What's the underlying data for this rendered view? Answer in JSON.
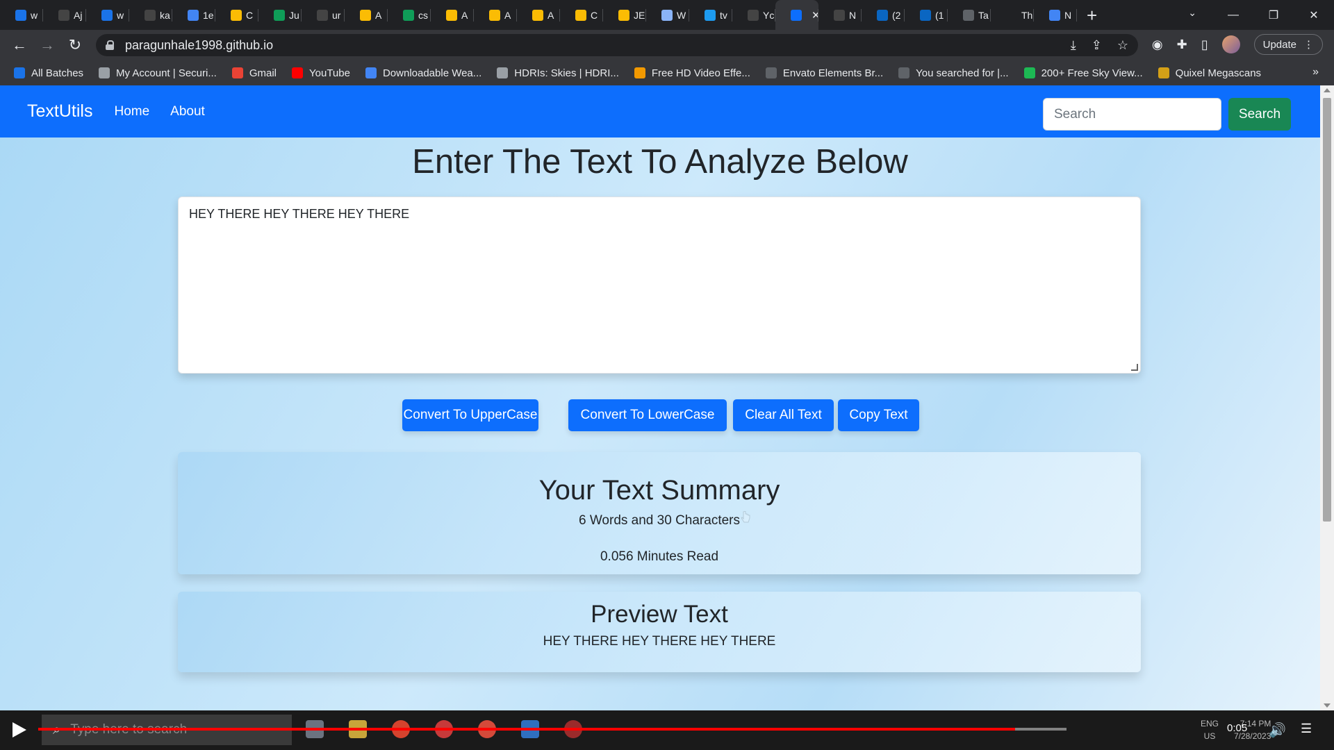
{
  "browser": {
    "tabs": [
      {
        "label": "w",
        "icon": "play-favicon-icon",
        "color": "#1a73e8"
      },
      {
        "label": "Aj",
        "icon": "github-favicon-icon",
        "color": "#444444"
      },
      {
        "label": "w",
        "icon": "play-favicon-icon",
        "color": "#1a73e8"
      },
      {
        "label": "ka",
        "icon": "github-favicon-icon",
        "color": "#444444"
      },
      {
        "label": "1e",
        "icon": "circle-favicon-icon",
        "color": "#4285f4"
      },
      {
        "label": "C",
        "icon": "drive-favicon-icon",
        "color": "#fbbc04"
      },
      {
        "label": "Ju",
        "icon": "sheets-favicon-icon",
        "color": "#0f9d58"
      },
      {
        "label": "ur",
        "icon": "github-favicon-icon",
        "color": "#444444"
      },
      {
        "label": "A",
        "icon": "drive-favicon-icon",
        "color": "#fbbc04"
      },
      {
        "label": "cs",
        "icon": "sheets-favicon-icon",
        "color": "#0f9d58"
      },
      {
        "label": "A",
        "icon": "drive-favicon-icon",
        "color": "#fbbc04"
      },
      {
        "label": "A",
        "icon": "drive-favicon-icon",
        "color": "#fbbc04"
      },
      {
        "label": "A",
        "icon": "drive-favicon-icon",
        "color": "#fbbc04"
      },
      {
        "label": "C",
        "icon": "drive-favicon-icon",
        "color": "#fbbc04"
      },
      {
        "label": "JE",
        "icon": "drive-favicon-icon",
        "color": "#fbbc04"
      },
      {
        "label": "W",
        "icon": "window-favicon-icon",
        "color": "#8ab4f8"
      },
      {
        "label": "tv",
        "icon": "twitter-favicon-icon",
        "color": "#1d9bf0"
      },
      {
        "label": "Yc",
        "icon": "github-favicon-icon",
        "color": "#444444"
      },
      {
        "label": "",
        "icon": "textutils-favicon-icon",
        "color": "#0d6efd",
        "active": true
      },
      {
        "label": "N",
        "icon": "github-favicon-icon",
        "color": "#444444"
      },
      {
        "label": "(2",
        "icon": "linkedin-favicon-icon",
        "color": "#0a66c2"
      },
      {
        "label": "(1",
        "icon": "linkedin-favicon-icon",
        "color": "#0a66c2"
      },
      {
        "label": "Ta",
        "icon": "bold-favicon-icon",
        "color": "#5f6368"
      },
      {
        "label": "Th",
        "icon": "a-favicon-icon",
        "color": "#202124"
      },
      {
        "label": "N",
        "icon": "cloud-favicon-icon",
        "color": "#4285f4"
      }
    ],
    "url": "paragunhale1998.github.io",
    "update_label": "Update",
    "bookmarks": [
      {
        "label": "All Batches",
        "color": "#1a73e8"
      },
      {
        "label": "My Account | Securi...",
        "color": "#9aa0a6"
      },
      {
        "label": "Gmail",
        "color": "#ea4335"
      },
      {
        "label": "YouTube",
        "color": "#ff0000"
      },
      {
        "label": "Downloadable Wea...",
        "color": "#4285f4"
      },
      {
        "label": "HDRIs: Skies | HDRI...",
        "color": "#9aa0a6"
      },
      {
        "label": "Free HD Video Effe...",
        "color": "#f29900"
      },
      {
        "label": "Envato Elements Br...",
        "color": "#5f6368"
      },
      {
        "label": "You searched for |...",
        "color": "#5f6368"
      },
      {
        "label": "200+ Free Sky View...",
        "color": "#1db954"
      },
      {
        "label": "Quixel Megascans",
        "color": "#d4a017"
      }
    ]
  },
  "app": {
    "brand": "TextUtils",
    "nav": {
      "home": "Home",
      "about": "About"
    },
    "search": {
      "placeholder": "Search",
      "button": "Search"
    },
    "heading": "Enter The Text To Analyze Below",
    "textarea_value": "HEY THERE HEY THERE HEY THERE",
    "buttons": {
      "upper": "Convert To UpperCase",
      "lower": "Convert To LowerCase",
      "clear": "Clear All Text",
      "copy": "Copy Text"
    },
    "summary": {
      "title": "Your Text Summary",
      "counts": "6 Words and 30 Characters",
      "read_time": "0.056 Minutes Read"
    },
    "preview": {
      "title": "Preview Text",
      "text": "HEY THERE HEY THERE HEY THERE"
    }
  },
  "player": {
    "search_placeholder": "Type here to search",
    "timecode": "0:05",
    "lang": "ENG",
    "region": "US",
    "time": "7:14 PM",
    "date": "7/28/2023",
    "progress": 0.95
  },
  "colors": {
    "navbar": "#0d6efd",
    "search_button": "#198754",
    "action_button": "#0d6efd"
  }
}
